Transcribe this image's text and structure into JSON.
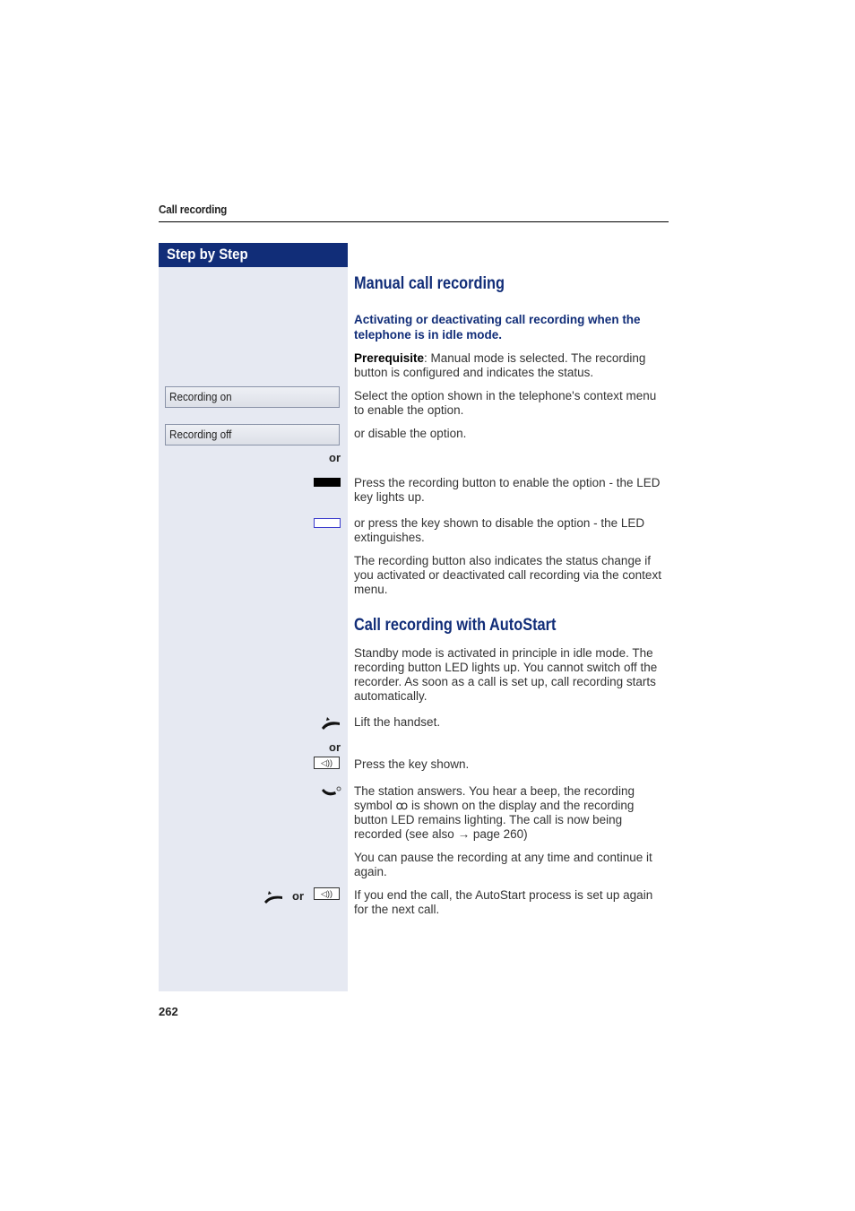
{
  "header": {
    "section_title": "Call recording"
  },
  "sidebar": {
    "title": "Step by Step",
    "menu_items": [
      {
        "label": "Recording on"
      },
      {
        "label": "Recording off"
      }
    ],
    "or_label": "or"
  },
  "manual": {
    "heading": "Manual call recording",
    "subheading": "Activating or deactivating call recording when the telephone is in idle mode.",
    "prereq_label": "Prerequisite",
    "prereq_text": ": Manual mode is selected. The recording button is configured and indicates the status.",
    "select_text": "Select the option shown in the telephone's context menu to enable the option.",
    "disable_text": "or disable the option.",
    "press_on_text": "Press the recording button to enable the option - the LED key lights up.",
    "press_off_text": "or press the key shown to disable the option - the LED extinguishes.",
    "status_text": "The recording button also indicates the status change if you activated or deactivated call recording via the context menu."
  },
  "autostart": {
    "heading": "Call recording with AutoStart",
    "intro": "Standby mode is activated in principle in idle mode. The recording button LED lights up. You cannot switch off the recorder. As soon as a call is set up, call recording starts automatically.",
    "lift_text": "Lift the handset.",
    "press_key_text": "Press the key shown.",
    "answers_text_1": "The station answers. You hear a beep, the recording symbol ",
    "recording_symbol": "ꝏ",
    "answers_text_2": " is shown on the display and the recording button LED remains lighting. The call is now being recorded (see also ",
    "arrow": "→",
    "answers_text_3": " page 260)",
    "pause_text": "You can pause the recording at any time and continue it again.",
    "end_text": "If you end the call, the AutoStart process is set up again for the next call."
  },
  "icons": {
    "speaker": "◁))"
  },
  "footer": {
    "page_number": "262"
  }
}
